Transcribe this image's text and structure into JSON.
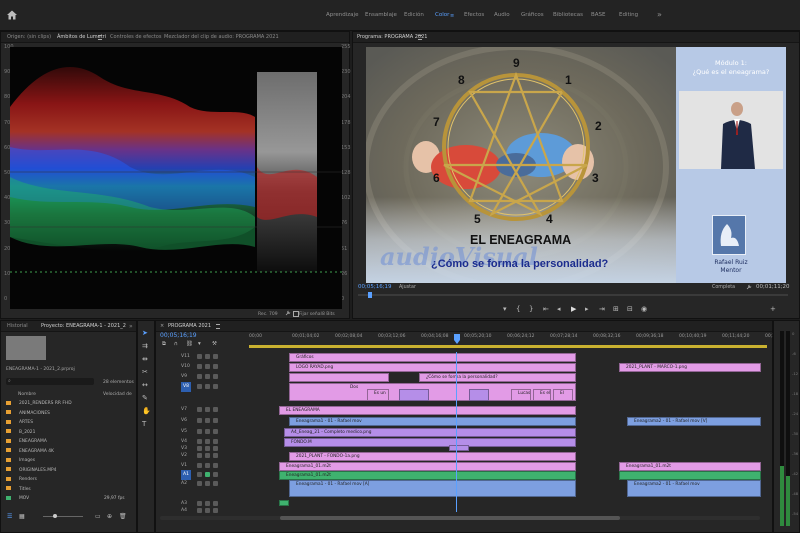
{
  "workspaces": {
    "items": [
      "Aprendizaje",
      "Ensamblaje",
      "Edición",
      "Color",
      "Efectos",
      "Audio",
      "Gráficos",
      "Bibliotecas",
      "BASE",
      "Editing"
    ],
    "active": "Color"
  },
  "scope_panel": {
    "tabs": [
      "Origen: (sin clips)",
      "Ámbitos de Lumetri",
      "Controles de efectos",
      "Mezclador del clip de audio: PROGRAMA 2021"
    ],
    "active_tab": "Ámbitos de Lumetri",
    "left_axis": [
      "100",
      "90",
      "80",
      "70",
      "60",
      "50",
      "40",
      "30",
      "20",
      "10",
      "0"
    ],
    "right_axis": [
      "255",
      "230",
      "204",
      "178",
      "153",
      "128",
      "102",
      "76",
      "51",
      "26",
      "0"
    ],
    "footer_left": "Rec. 709",
    "footer_right": "Fijar señal",
    "footer_value": "8 Bits"
  },
  "program_monitor": {
    "title": "Programa: PROGRAMA 2021",
    "timecode_current": "00;05;16;19",
    "fit_label": "Ajustar",
    "quality_label": "Completa",
    "timecode_duration": "00;01;11;20",
    "video": {
      "enneagram_numbers": [
        "9",
        "1",
        "2",
        "3",
        "4",
        "5",
        "6",
        "7",
        "8"
      ],
      "title_text": "EL ENEAGRAMA",
      "subtitle_text": "¿Cómo se forma la personalidad?",
      "watermark_text": "audioVisual",
      "module_title": "Módulo 1:",
      "module_subtitle": "¿Qué es el eneagrama?",
      "presenter_name": "Rafael Ruiz",
      "presenter_role": "Mentor"
    }
  },
  "project_panel": {
    "tabs": [
      "Historial",
      "Proyecto: ENEAGRAMA-1 - 2021_2"
    ],
    "active_tab": "Proyecto: ENEAGRAMA-1 - 2021_2",
    "project_file": "ENEAGRAMA-1 - 2021_2.prproj",
    "item_count": "28 elementos",
    "column_name": "Nombre",
    "column_speed": "Velocidad de",
    "items": [
      {
        "name": "2021_RENDERS RR FHD",
        "type": "folder"
      },
      {
        "name": "ANIMACIONES",
        "type": "folder"
      },
      {
        "name": "ARTES",
        "type": "folder"
      },
      {
        "name": "B_2021",
        "type": "folder"
      },
      {
        "name": "ENEAGRAMA",
        "type": "folder"
      },
      {
        "name": "ENEAGRAMA 4K",
        "type": "folder"
      },
      {
        "name": "Images",
        "type": "folder"
      },
      {
        "name": "ORIGINALES.MP4",
        "type": "folder"
      },
      {
        "name": "Renders",
        "type": "folder"
      },
      {
        "name": "Titles",
        "type": "folder"
      },
      {
        "name": "MOV",
        "type": "file",
        "speed": "29,97 fps"
      }
    ]
  },
  "timeline": {
    "tab": "PROGRAMA 2021",
    "timecode": "00;05;16;19",
    "ruler": [
      "00;00",
      "00;01;04;02",
      "00;02;08;04",
      "00;03;12;06",
      "00;04;16;08",
      "00;05;20;10",
      "00;06;24;12",
      "00;07;28;14",
      "00;08;32;16",
      "00;09;36;18",
      "00;10;40;19",
      "00;11;44;20",
      "00;12;48;23"
    ],
    "video_tracks": [
      "V11",
      "V10",
      "V9",
      "V8",
      "V7",
      "V6",
      "V5",
      "V4",
      "V3",
      "V2",
      "V1"
    ],
    "audio_tracks": [
      "A1",
      "A2",
      "A3",
      "A4"
    ],
    "clips": {
      "graficos": "Gráficos",
      "logo": "LOGO RAYAD.png",
      "como": "¿Cómo se forma la personalidad?",
      "eneagrama": "EL ENEAGRAMA",
      "eneagrama1": "Eneagrama1 - 01 - Rafael mov",
      "eneagrama2": "Eneagrama2 - 01 - Rafael mov [V]",
      "completo": "A4_Eneag_21 - Completo medico.png",
      "fondo": "FONDO.M",
      "plant": "2021_PLANT - FONDO-1a.png",
      "plant2": "2021_PLANT - MARCO-1.png",
      "v1a": "Eneagrama1_01.m2t",
      "v1b": "Eneagrama1_01.m2t",
      "audio1": "Eneagrama1_01.m2t",
      "audio2": "Eneagrama1 - 01 - Rafael mov [A]",
      "audio3": "Eneagrama2 - 01 - Rafael mov",
      "sub": "Dos",
      "sub2": "Es un",
      "sub3": "Lucas",
      "sub4": "Es el",
      "sub5": "El"
    }
  },
  "meters": {
    "scale": [
      "0",
      "-6",
      "-12",
      "-18",
      "-24",
      "-30",
      "-36",
      "-42",
      "-48",
      "-54"
    ]
  },
  "colors": {
    "accent": "#5aa0ff",
    "pink_clip": "#e29be6",
    "purple_clip": "#b58ee8",
    "blue_clip": "#7d9fe0",
    "green_clip": "#3fb26f",
    "folder": "#e8a033"
  }
}
